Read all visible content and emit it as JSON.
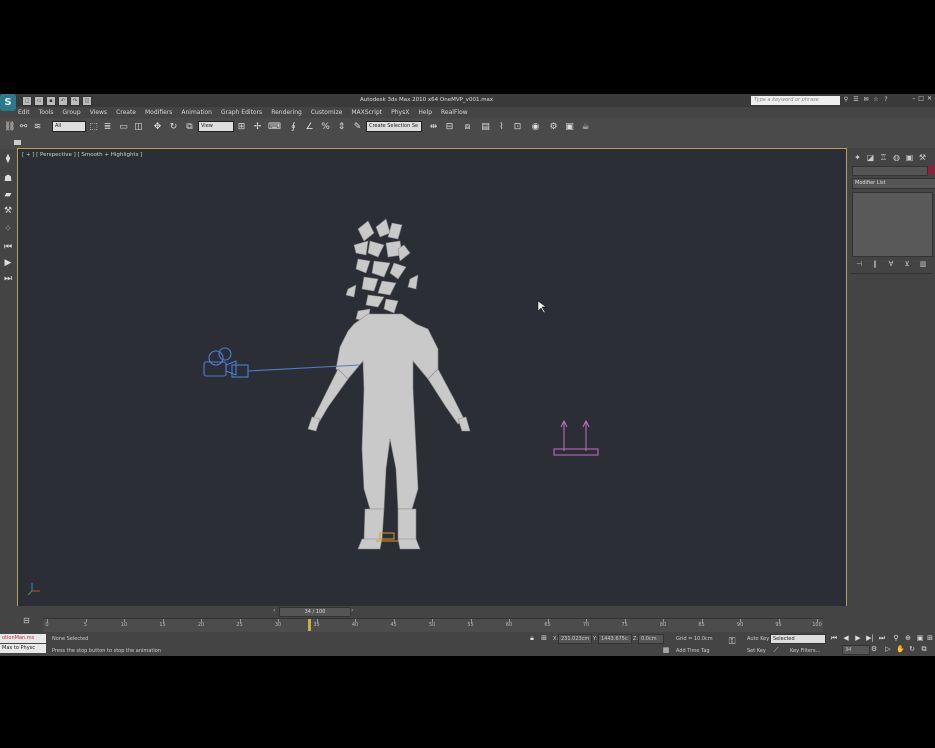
{
  "app": {
    "title": "Autodesk 3ds Max 2010 x64     OneMVP_v001.max",
    "logo": "S"
  },
  "search": {
    "placeholder": "Type a keyword or phrase"
  },
  "menus": [
    "Edit",
    "Tools",
    "Group",
    "Views",
    "Create",
    "Modifiers",
    "Animation",
    "Graph Editors",
    "Rendering",
    "Customize",
    "MAXScript",
    "PhysX",
    "Help",
    "RealFlow"
  ],
  "toolbar": {
    "selection_filter": "All",
    "ref_coord": "View",
    "named_selection": "Create Selection Se"
  },
  "viewport": {
    "label": "[ + ] [ Perspective ] [ Smooth + Highlights ]"
  },
  "command_panel": {
    "modifier_list": "Modifier List"
  },
  "timeline": {
    "frame_display": "34 / 100",
    "current_frame": 34,
    "max_frame": 100,
    "ticks": [
      "0",
      "5",
      "10",
      "15",
      "20",
      "25",
      "30",
      "35",
      "40",
      "45",
      "50",
      "55",
      "60",
      "65",
      "70",
      "75",
      "80",
      "85",
      "90",
      "95",
      "100"
    ]
  },
  "status": {
    "maxscript_line1": "otionMan.ms",
    "maxscript_line2": "Max to Physc",
    "selection": "None Selected",
    "prompt": "Press the stop button to stop the animation",
    "x": "231.023cm",
    "y": "1443.675c",
    "z": "0.0cm",
    "grid": "Grid = 10.0cm",
    "add_time_tag": "Add Time Tag",
    "auto_key": "Auto Key",
    "set_key": "Set Key",
    "key_filters": "Key Filters...",
    "key_mode": "Selected",
    "frame_field": "34"
  },
  "colors": {
    "viewport_bg": "#2b2f35",
    "active_border": "#b8a050",
    "camera": "#4a7fd0",
    "helper": "#c070c0",
    "character": "#c8c8c8"
  }
}
